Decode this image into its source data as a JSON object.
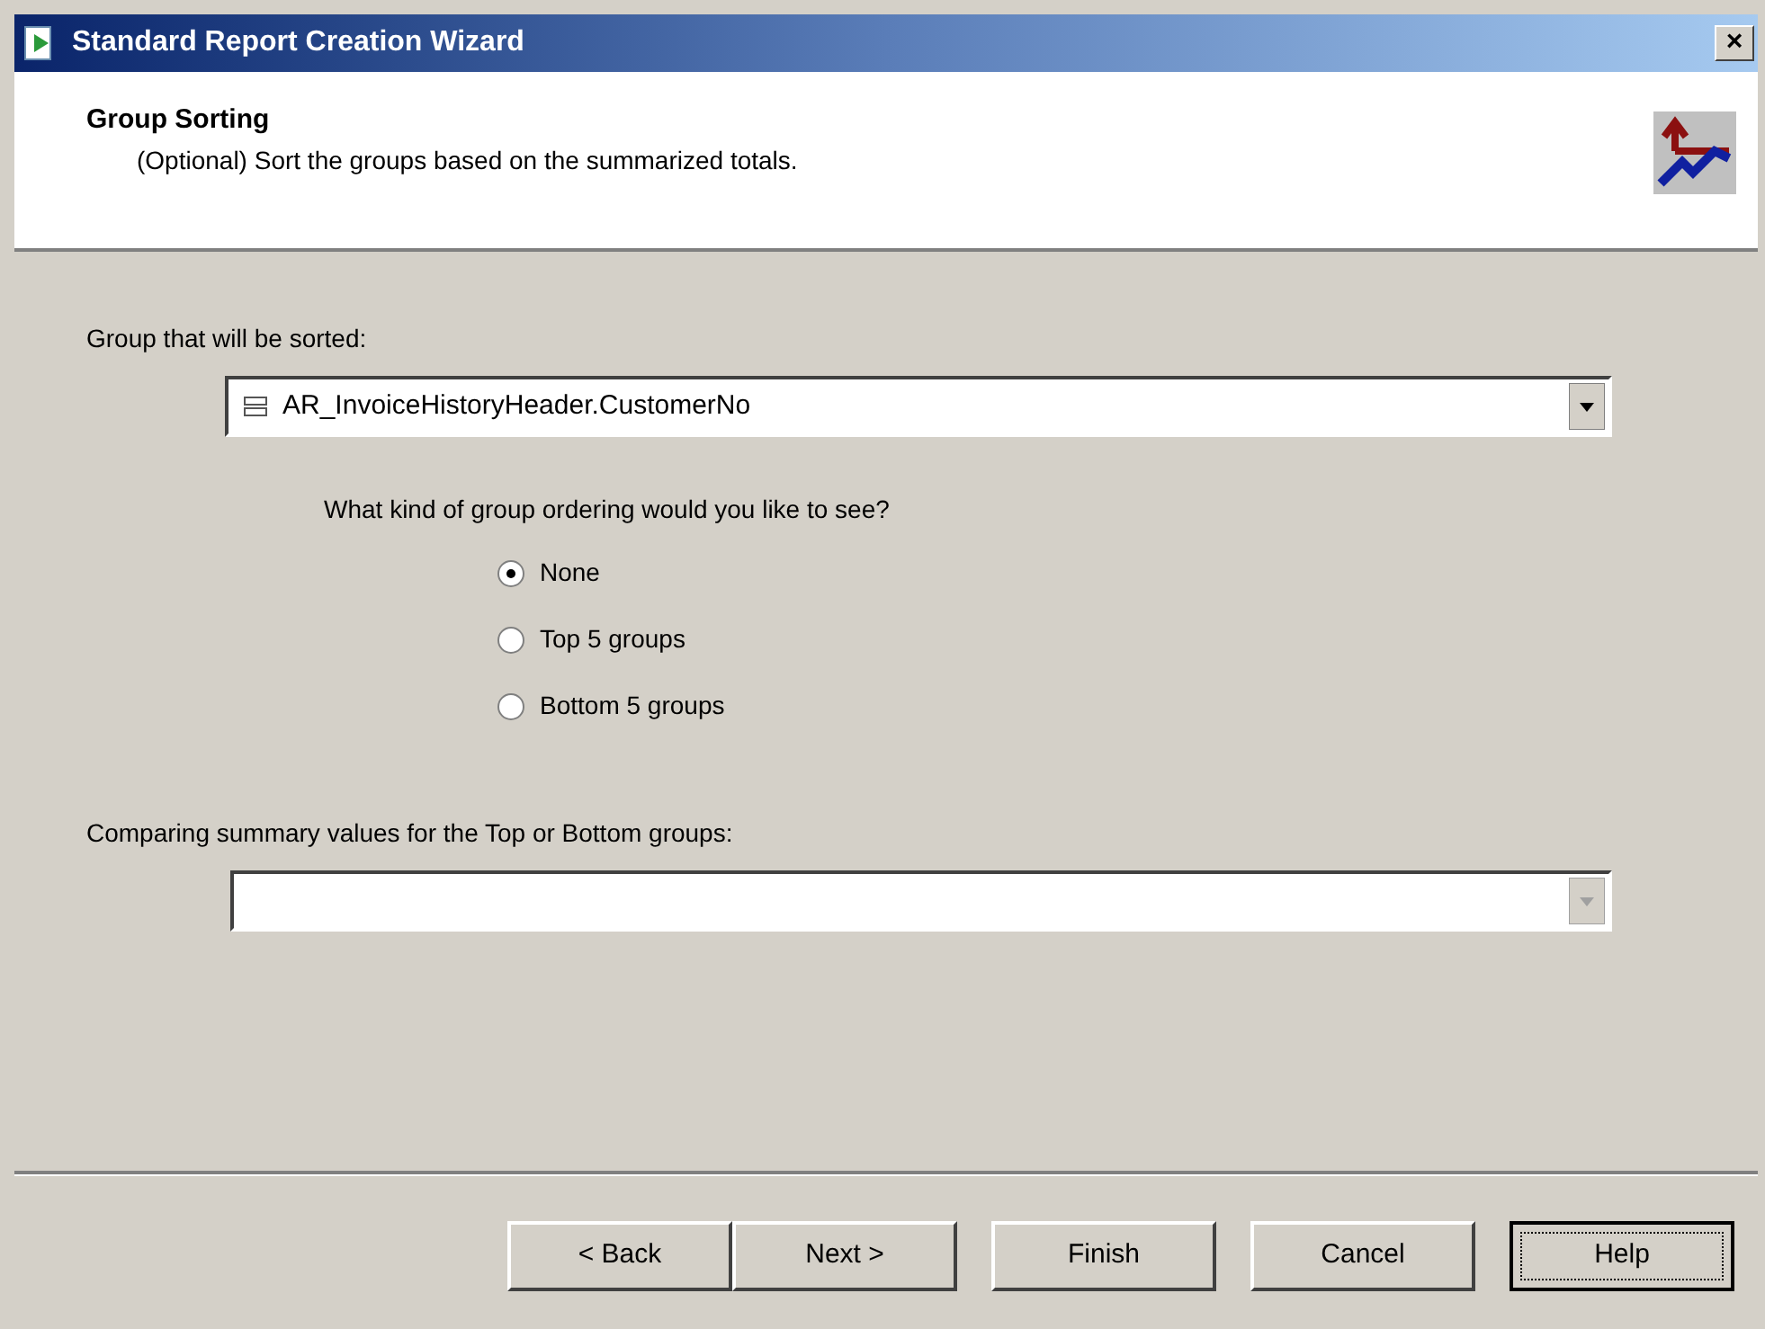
{
  "window": {
    "title": "Standard Report Creation Wizard",
    "close": "×"
  },
  "header": {
    "title": "Group Sorting",
    "subtitle": "(Optional) Sort the groups based on the summarized totals."
  },
  "group_field": {
    "label": "Group that will be sorted:",
    "value": "AR_InvoiceHistoryHeader.CustomerNo",
    "disabled": false
  },
  "ordering": {
    "question": "What kind of group ordering would you like to see?",
    "options": [
      {
        "label": "None",
        "selected": true
      },
      {
        "label": "Top 5 groups",
        "selected": false
      },
      {
        "label": "Bottom 5 groups",
        "selected": false
      }
    ]
  },
  "summary_field": {
    "label": "Comparing summary values for the Top or Bottom groups:",
    "disabled": true
  },
  "buttons": [
    {
      "label": "< Back",
      "default": false
    },
    {
      "label": "Next >",
      "default": false
    },
    {
      "label": "Finish",
      "default": false
    },
    {
      "label": "Cancel",
      "default": false
    },
    {
      "label": "Help",
      "default": true
    }
  ]
}
